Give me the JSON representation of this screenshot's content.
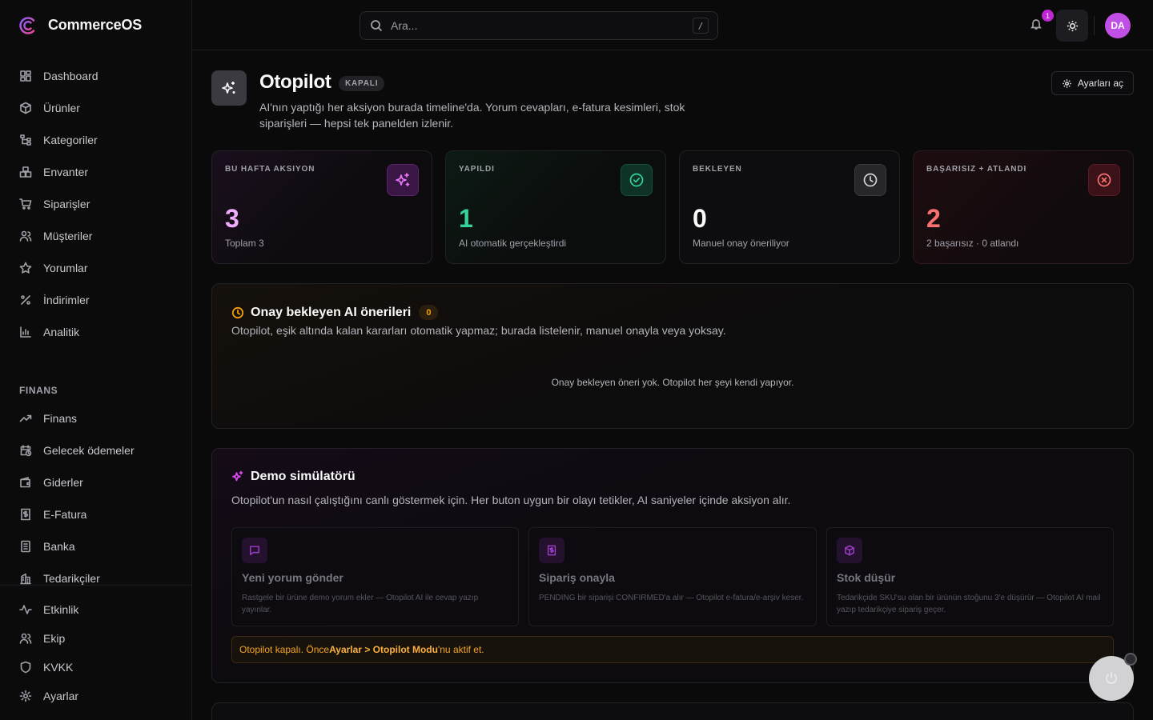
{
  "app": {
    "name": "CommerceOS"
  },
  "sidebar": {
    "items": [
      {
        "label": "Dashboard",
        "icon": "dashboard-icon"
      },
      {
        "label": "Ürünler",
        "icon": "box-icon"
      },
      {
        "label": "Kategoriler",
        "icon": "tree-icon"
      },
      {
        "label": "Envanter",
        "icon": "boxes-icon"
      },
      {
        "label": "Siparişler",
        "icon": "cart-icon"
      },
      {
        "label": "Müşteriler",
        "icon": "users-icon"
      },
      {
        "label": "Yorumlar",
        "icon": "star-icon"
      },
      {
        "label": "İndirimler",
        "icon": "percent-icon"
      },
      {
        "label": "Analitik",
        "icon": "bar-chart-icon"
      }
    ],
    "finance_section": "FINANS",
    "finance_items": [
      {
        "label": "Finans",
        "icon": "trend-icon"
      },
      {
        "label": "Gelecek ödemeler",
        "icon": "calendar-clock-icon"
      },
      {
        "label": "Giderler",
        "icon": "wallet-icon"
      },
      {
        "label": "E-Fatura",
        "icon": "receipt-icon"
      },
      {
        "label": "Banka",
        "icon": "bank-icon"
      },
      {
        "label": "Tedarikçiler",
        "icon": "building-icon"
      }
    ],
    "bottom_items": [
      {
        "label": "Etkinlik",
        "icon": "activity-icon"
      },
      {
        "label": "Ekip",
        "icon": "team-icon"
      },
      {
        "label": "KVKK",
        "icon": "shield-icon"
      },
      {
        "label": "Ayarlar",
        "icon": "gear-icon"
      }
    ]
  },
  "topbar": {
    "search_placeholder": "Ara...",
    "search_shortcut": "/",
    "notification_count": "1",
    "avatar_initials": "DA"
  },
  "header": {
    "title": "Otopilot",
    "status": "KAPALI",
    "description": "AI'nın yaptığı her aksiyon burada timeline'da. Yorum cevapları, e-fatura kesimleri, stok siparişleri — hepsi tek panelden izlenir.",
    "settings_button": "Ayarları aç"
  },
  "stats": [
    {
      "label": "BU HAFTA AKSIYON",
      "value": "3",
      "sub": "Toplam 3",
      "accent": "#e879f9",
      "icon": "sparkles-icon"
    },
    {
      "label": "YAPILDI",
      "value": "1",
      "sub": "AI otomatik gerçekleştirdi",
      "accent": "#34d399",
      "icon": "check-circle-icon"
    },
    {
      "label": "BEKLEYEN",
      "value": "0",
      "sub": "Manuel onay öneriliyor",
      "accent": "#fafafa",
      "icon": "clock-icon"
    },
    {
      "label": "BAŞARISIZ + ATLANDI",
      "value": "2",
      "sub": "2 başarısız · 0 atlandı",
      "accent": "#f87171",
      "icon": "x-circle-icon"
    }
  ],
  "pending": {
    "title": "Onay bekleyen AI önerileri",
    "count": "0",
    "description": "Otopilot, eşik altında kalan kararları otomatik yapmaz; burada listelenir, manuel onayla veya yoksay.",
    "empty": "Onay bekleyen öneri yok. Otopilot her şeyi kendi yapıyor."
  },
  "simulator": {
    "title": "Demo simülatörü",
    "description": "Otopilot'un nasıl çalıştığını canlı göstermek için. Her buton uygun bir olayı tetikler, AI saniyeler içinde aksiyon alır.",
    "cards": [
      {
        "title": "Yeni yorum gönder",
        "desc": "Rastgele bir ürüne demo yorum ekler — Otopilot AI ile cevap yazıp yayınlar.",
        "icon": "message-icon"
      },
      {
        "title": "Sipariş onayla",
        "desc": "PENDING bir siparişi CONFIRMED'a alır — Otopilot e-fatura/e-arşiv keser.",
        "icon": "receipt-icon"
      },
      {
        "title": "Stok düşür",
        "desc": "Tedarikçide SKU'su olan bir ürünün stoğunu 3'e düşürür — Otopilot AI mail yazıp tedarikçiye sipariş geçer.",
        "icon": "box-icon"
      }
    ],
    "warning_prefix": "Otopilot kapalı. Önce ",
    "warning_link": "Ayarlar > Otopilot Modu",
    "warning_suffix": "'nu aktif et."
  }
}
